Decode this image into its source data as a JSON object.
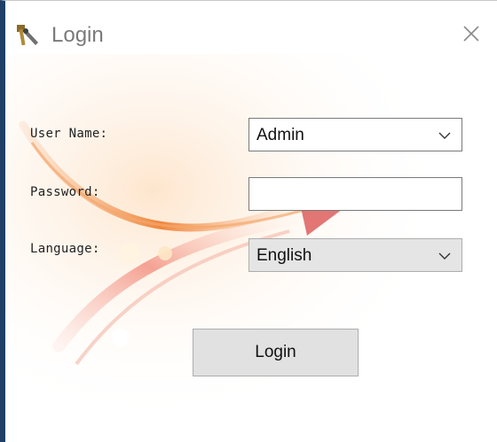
{
  "window": {
    "title": "Login",
    "icon": "tools-icon",
    "close_icon": "close-icon"
  },
  "form": {
    "username_label": "User Name:",
    "username_value": "Admin",
    "password_label": "Password:",
    "password_value": "",
    "language_label": "Language:",
    "language_value": "English",
    "login_button": "Login"
  },
  "colors": {
    "window_border": "#1f3f66",
    "button_bg": "#e1e1e1",
    "accent_orange": "#f08a2a"
  }
}
